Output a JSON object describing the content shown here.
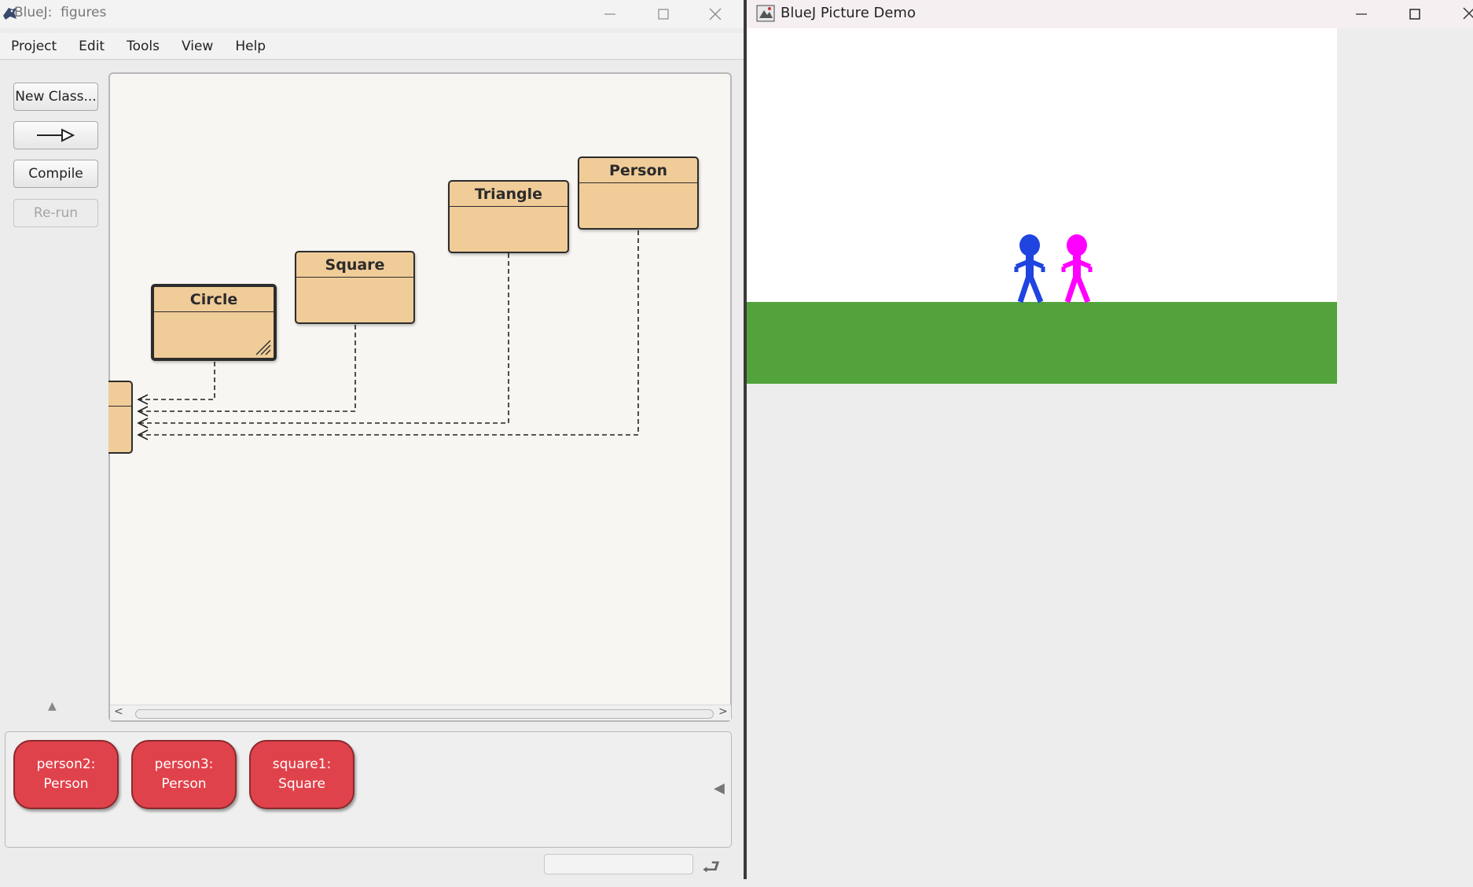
{
  "bluej": {
    "title": "BlueJ:  figures",
    "menu": [
      "Project",
      "Edit",
      "Tools",
      "View",
      "Help"
    ],
    "toolbar": {
      "new_class_label": "New Class...",
      "compile_label": "Compile",
      "rerun_label": "Re-run"
    },
    "classes": {
      "circle": "Circle",
      "square": "Square",
      "triangle": "Triangle",
      "person": "Person"
    },
    "objects": [
      {
        "line1": "person2:",
        "line2": "Person"
      },
      {
        "line1": "person3:",
        "line2": "Person"
      },
      {
        "line1": "square1:",
        "line2": "Square"
      }
    ]
  },
  "picture_demo": {
    "title": "BlueJ Picture Demo",
    "colors": {
      "sky": "#ffffff",
      "grass": "#52a33b",
      "person_blue": "#1f44e0",
      "person_magenta": "#ff00ff"
    }
  },
  "colors": {
    "class_fill": "#f0cc98",
    "object_fill": "#e0424b"
  }
}
